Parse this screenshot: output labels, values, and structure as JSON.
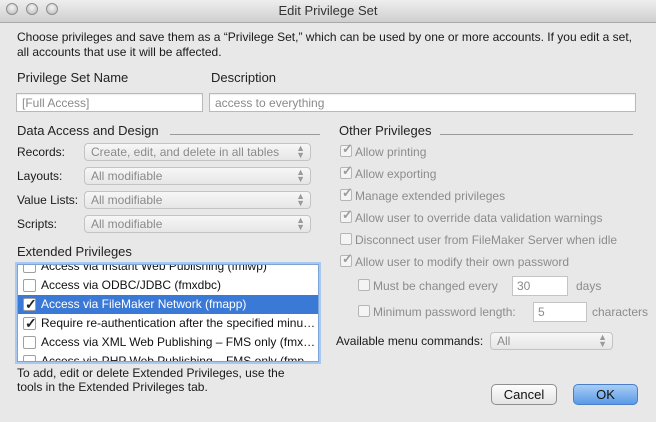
{
  "window": {
    "title": "Edit Privilege Set"
  },
  "intro": "Choose privileges and save them as a “Privilege Set,” which can be used by one or more accounts. If you edit a set, all accounts that use it will be affected.",
  "name": {
    "label": "Privilege Set Name",
    "value": "[Full Access]"
  },
  "description": {
    "label": "Description",
    "value": "access to everything"
  },
  "data_access": {
    "title": "Data Access and Design",
    "records": {
      "label": "Records:",
      "value": "Create, edit, and delete in all tables"
    },
    "layouts": {
      "label": "Layouts:",
      "value": "All modifiable"
    },
    "value_lists": {
      "label": "Value Lists:",
      "value": "All modifiable"
    },
    "scripts": {
      "label": "Scripts:",
      "value": "All modifiable"
    }
  },
  "extended": {
    "title": "Extended Privileges",
    "items": [
      {
        "label": "Access via Instant Web Publishing (fmiwp)",
        "checked": false
      },
      {
        "label": "Access via ODBC/JDBC (fmxdbc)",
        "checked": false
      },
      {
        "label": "Access via FileMaker Network (fmapp)",
        "checked": true
      },
      {
        "label": "Require re-authentication after the specified minutes",
        "checked": true
      },
      {
        "label": "Access via XML Web Publishing – FMS only (fmxml)",
        "checked": false
      },
      {
        "label": "Access via PHP Web Publishing – FMS only (fmphp)",
        "checked": false
      }
    ],
    "hint": "To add, edit or delete Extended Privileges, use the tools in the Extended Privileges tab."
  },
  "other": {
    "title": "Other Privileges",
    "allow_printing": "Allow printing",
    "allow_exporting": "Allow exporting",
    "manage_extended": "Manage extended privileges",
    "override_validation": "Allow user to override data validation warnings",
    "disconnect_idle": "Disconnect user from FileMaker Server when idle",
    "modify_password": "Allow user to modify their own password",
    "change_every": {
      "label": "Must be changed every",
      "value": "30",
      "unit": "days"
    },
    "min_length": {
      "label": "Minimum password length:",
      "value": "5",
      "unit": "characters"
    },
    "menu_commands": {
      "label": "Available menu commands:",
      "value": "All"
    }
  },
  "buttons": {
    "cancel": "Cancel",
    "ok": "OK"
  }
}
